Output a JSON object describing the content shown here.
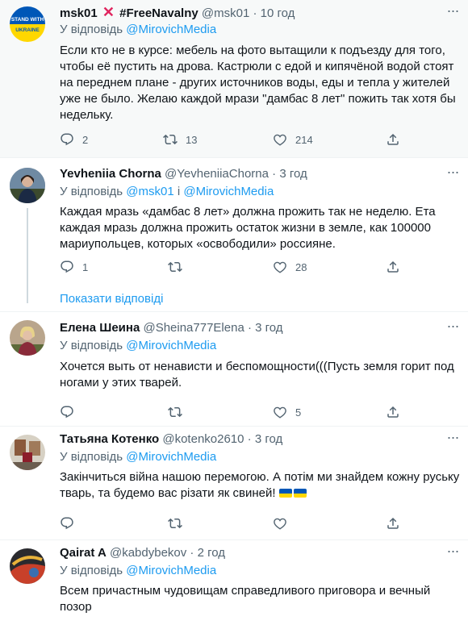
{
  "tweets": [
    {
      "name": "msk01",
      "name_suffix": "#FreeNavalny",
      "handle": "@msk01",
      "time": "10 год",
      "reply_prefix": "У відповідь",
      "mentions": "@MirovichMedia",
      "text": "Если кто не в курсе: мебель на фото вытащили к подъезду для того, чтобы её пустить на дрова. Кастрюли с едой и кипячёной водой стоят на переднем плане - других источников воды, еды и тепла у жителей уже не было. Желаю каждой мрази \"дамбас 8 лет\" пожить так хотя бы недельку.",
      "replies": "2",
      "retweets": "13",
      "likes": "214",
      "avatar_text": "STAND WITH UKRAINE"
    },
    {
      "name": "Yevheniia Chorna",
      "handle": "@YevheniiaChorna",
      "time": "3 год",
      "reply_prefix": "У відповідь",
      "mentions_1": "@msk01",
      "mentions_join": "і",
      "mentions_2": "@MirovichMedia",
      "text": "Каждая мразь «дамбас 8 лет» должна прожить так не неделю. Ета каждая мразь должна прожить остаток жизни в земле, как 100000 мариупольцев, которых «освободили» россияне.",
      "replies": "1",
      "retweets": "",
      "likes": "28",
      "show_replies": "Показати відповіді"
    },
    {
      "name": "Елена Шеина",
      "handle": "@Sheina777Elena",
      "time": "3 год",
      "reply_prefix": "У відповідь",
      "mentions": "@MirovichMedia",
      "text": "Хочется выть от ненависти и беспомощности(((Пусть земля горит под ногами у этих тварей.",
      "replies": "",
      "retweets": "",
      "likes": "5"
    },
    {
      "name": "Татьяна Котенко",
      "handle": "@kotenko2610",
      "time": "3 год",
      "reply_prefix": "У відповідь",
      "mentions": "@MirovichMedia",
      "text": "Закінчиться війна нашою перемогою. А потім ми знайдем кожну руську тварь, та будемо вас різати як свиней!",
      "replies": "",
      "retweets": "",
      "likes": ""
    },
    {
      "name": "Qairat A",
      "handle": "@kabdybekov",
      "time": "2 год",
      "reply_prefix": "У відповідь",
      "mentions": "@MirovichMedia",
      "text": "Всем причастным чудовищам  справедливого приговора и вечный позор"
    }
  ],
  "colors": {
    "accent": "#1d9bf0",
    "muted": "#536471",
    "text": "#0f1419",
    "ua_blue": "#0057b7",
    "ua_yellow": "#ffd700"
  }
}
